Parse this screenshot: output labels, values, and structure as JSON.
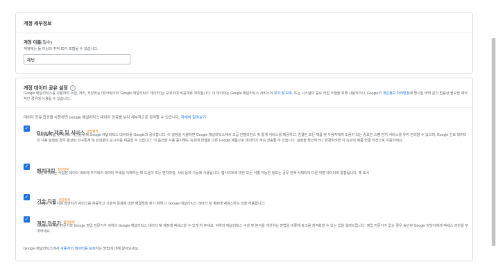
{
  "account_details": {
    "title": "계정 세부정보",
    "name_label": "계정 이름",
    "name_required": "(필수)",
    "name_hint": "계정에는 둘 이상의 추적 ID가 포함될 수 있습니다.",
    "name_value": "레빗"
  },
  "data_sharing": {
    "title": "계정 데이터 공유 설정",
    "help_icon": "?",
    "intro_text_1": "Google 애널리틱스를 사용하여 수집, 처리, 저장하는 데이터(이하 'Google 애널리틱스 데이터')는 보호되며 비공개로 처리됩니다. 이 데이터는 Google 애널리틱스 서비스의 ",
    "intro_link_1": "유지 및 보호",
    "intro_text_2": ", 또는 시스템의 중요 작업 수행을 위해 사용되거나, Google의 ",
    "intro_link_2": "개인정보 처리방침",
    "intro_text_3": "에 명시된 바와 같이 법률상 필요한 예외적인 경우에 사용될 수 있습니다.",
    "more_text": "데이터 공유 옵션을 사용하면 Google 애널리틱스 데이터 공유를 보다 세부적으로 관리할 수 있습니다. ",
    "more_link": "자세히 알아보기",
    "options": [
      {
        "title": "Google 제품 및 서비스",
        "badge": "권장항목",
        "desc_1": "Google 제품 및 서비스 개선을 위해 Google 애널리틱스 데이터를 Google과 공유합니다. 이 설정을 사용하면 Google 애널리틱스에서 고급 인텔리전스 및 통계 서비스를 제공하고, 연결된 모든 제품 및 사용자에게 도움이 되는 중요한 스팸 감지 서비스를 유지 관리할 수 있으며, ",
        "link_1": "Google 신호 데이터",
        "desc_2": "의 사용 설정된 경우 ",
        "link_2": "향상된 인구통계 및 관심분야 보고서",
        "desc_3": "를 제공할 수 있습니다. 이 옵션을 사용 중지해도 속성에 연결된 다른 Google 제품으로 데이터가 계속 전송될 수 있습니다. 설정을 확인하거나 변경하려면 각 속성의 제품 연결 섹션으로 이동하세요."
      },
      {
        "title": "벤치마킹",
        "badge": "권장항목",
        "desc_1": "익명 데이터는 수집된 데이터 세트에 추가되어 데이터 추세를 이해하는 데 도움이 되는 벤치마킹, 서비 등의 기능에 사용됩니다. 웹사이트에 대한 모든 식별 가능한 정보는 공유 전에 삭제되어 다른 익명 데이터와 통합됩니다. ",
        "link_1": "예 표시",
        "desc_2": "",
        "link_2": "",
        "desc_3": ""
      },
      {
        "title": "기술 지원",
        "badge": "권장항목",
        "desc_1": "Google 기술 지원 담당자가 서비스를 제공하고 기술적 문제에 대한 해결책을 찾기 위해 니 Google 애널리틱스 데이터 및 계정에 액세스하는 것을 허용합니다.",
        "link_1": "",
        "desc_2": "",
        "link_2": "",
        "desc_3": ""
      },
      {
        "title": "계정 전문가",
        "badge": "권장항목",
        "desc_1": "Google 마케팅 전문가와 Google 영업 전문가가 귀하의 Google 애널리틱스 데이터 및 계정에 액세스할 수 있게 허 주세요. 귀하의 애널리틱스 구성 및 분석을 개선하는 방법을 비롯해 광고를 최적화할 수 있는 입을 얼려드립니다. 영업 전문가가 없는 경우 승인된 Google 담당자에게 액세스 권한을 부여하세요.",
        "link_1": "",
        "desc_2": "",
        "link_2": "",
        "desc_3": ""
      }
    ],
    "footer_text_1": "Google 애널리틱스에서 ",
    "footer_link": "사용자의 데이터를 보호",
    "footer_text_2": "하는 방법에 대해 알아보세요."
  },
  "icons": {
    "checkbox": "check-icon",
    "help": "help-circle-icon"
  },
  "colors": {
    "accent": "#1a73e8",
    "badge": "#e37400",
    "border": "#dadce0"
  }
}
